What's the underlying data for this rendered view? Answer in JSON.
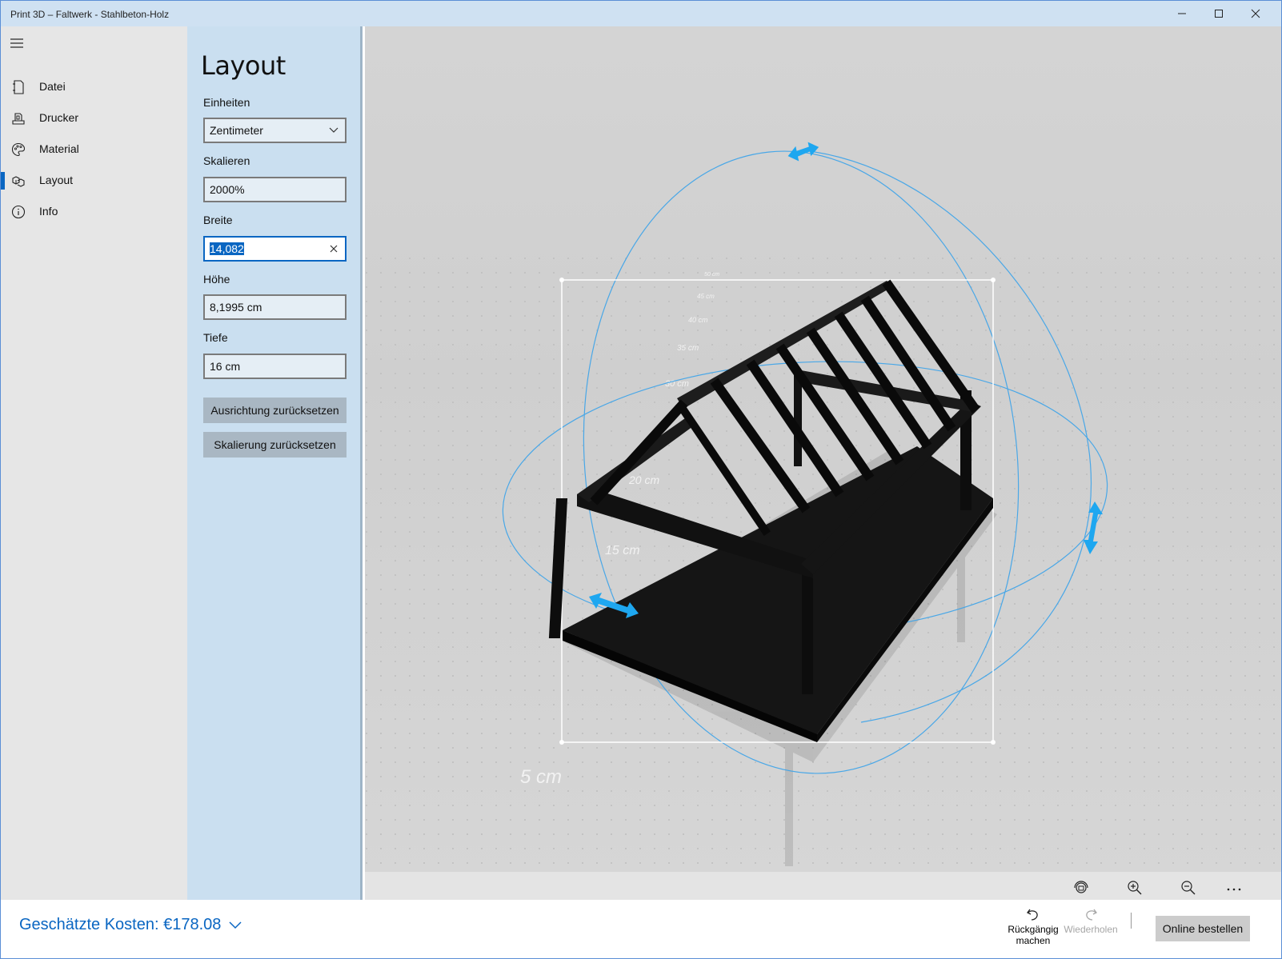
{
  "window": {
    "title": "Print 3D – Faltwerk - Stahlbeton-Holz"
  },
  "nav": {
    "items": [
      {
        "label": "Datei",
        "icon": "file-icon"
      },
      {
        "label": "Drucker",
        "icon": "printer-icon"
      },
      {
        "label": "Material",
        "icon": "palette-icon"
      },
      {
        "label": "Layout",
        "icon": "layout-icon",
        "active": true
      },
      {
        "label": "Info",
        "icon": "info-icon"
      }
    ]
  },
  "panel": {
    "title": "Layout",
    "units_label": "Einheiten",
    "units_value": "Zentimeter",
    "scale_label": "Skalieren",
    "scale_value": "2000%",
    "width_label": "Breite",
    "width_value": "14,082",
    "height_label": "Höhe",
    "height_value": "8,1995 cm",
    "depth_label": "Tiefe",
    "depth_value": "16 cm",
    "reset_orientation": "Ausrichtung zurücksetzen",
    "reset_scale": "Skalierung zurücksetzen"
  },
  "viewport": {
    "grid_labels": [
      "50 cm",
      "45 cm",
      "40 cm",
      "35 cm",
      "30 cm",
      "20 cm",
      "15 cm",
      "5 cm"
    ]
  },
  "bottom": {
    "cost_label": "Geschätzte Kosten: €178.08",
    "undo_label_1": "Rückgängig",
    "undo_label_2": "machen",
    "redo_label": "Wiederholen",
    "order_label": "Online bestellen"
  },
  "colors": {
    "accent": "#0a66c2",
    "panel_bg": "#cadff0",
    "nav_bg": "#e6e6e6",
    "titlebar_bg": "#cfe1f2",
    "gizmo": "#1ea7f0"
  }
}
